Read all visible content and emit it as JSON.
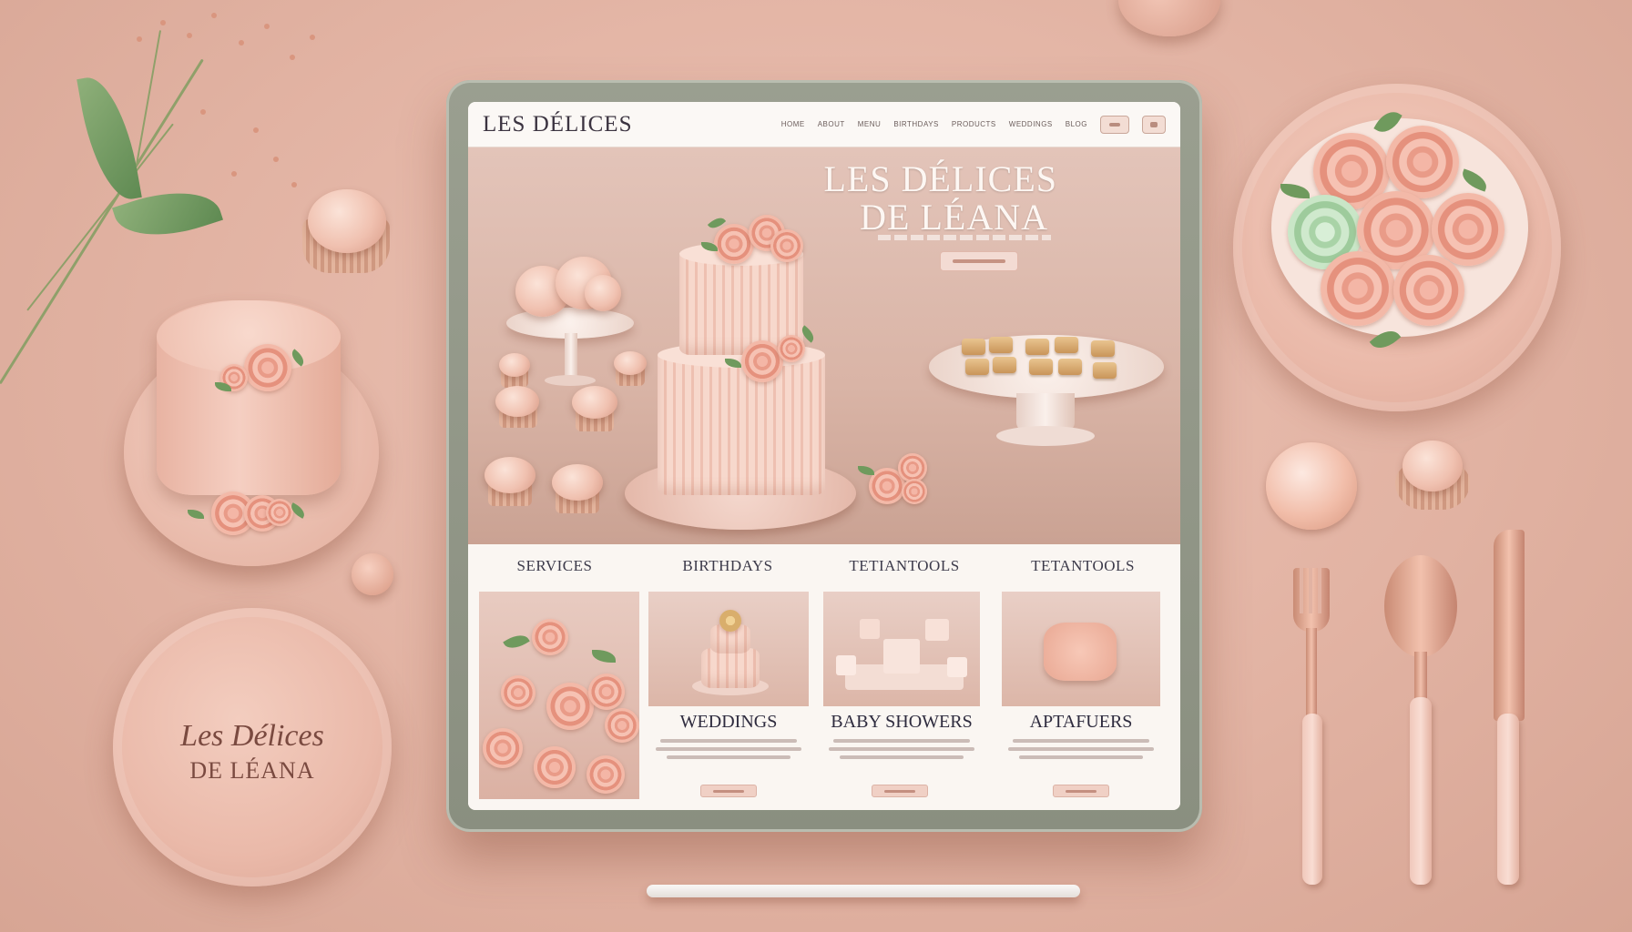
{
  "plate_logo": {
    "line1": "Les Délices",
    "line2": "DE LÉANA"
  },
  "site": {
    "brand": "LES DÉLICES",
    "nav": {
      "links": [
        {
          "label": "HOME"
        },
        {
          "label": "ABOUT"
        },
        {
          "label": "MENU"
        },
        {
          "label": "BIRTHDAYS"
        },
        {
          "label": "PRODUCTS"
        },
        {
          "label": "WEDDINGS"
        },
        {
          "label": "BLOG"
        }
      ]
    },
    "hero": {
      "title_line1": "LES DÉLICES",
      "title_line2": "DE LÉANA"
    },
    "services": {
      "headings": [
        "SERVICES",
        "BIRTHDAYS",
        "TETIANTOOLS",
        "TETANTOOLS"
      ],
      "cards": [
        {
          "label": "WEDDINGS"
        },
        {
          "label": "BABY SHOWERS"
        },
        {
          "label": "APTAFUERS"
        }
      ]
    }
  },
  "colors": {
    "background": "#e2b3a3",
    "accent": "#e99b88",
    "text_dark": "#3b3340",
    "tablet_frame": "#8a8f80"
  }
}
